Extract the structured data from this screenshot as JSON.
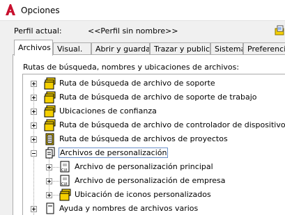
{
  "window": {
    "title": "Opciones"
  },
  "profile": {
    "label": "Perfil actual:",
    "value": "<<Perfil sin nombre>>"
  },
  "tabs": [
    {
      "label": "Archivos"
    },
    {
      "label": "Visual."
    },
    {
      "label": "Abrir y guardar"
    },
    {
      "label": "Trazar y publicar"
    },
    {
      "label": "Sistema"
    },
    {
      "label": "Preferencias de usuario"
    }
  ],
  "section_label": "Rutas de búsqueda, nombres y ubicaciones de archivos:",
  "tree": {
    "items": [
      {
        "label": "Ruta de búsqueda de archivo de soporte"
      },
      {
        "label": "Ruta de búsqueda de archivo de soporte de trabajo"
      },
      {
        "label": "Ubicaciones de confianza"
      },
      {
        "label": "Ruta de búsqueda de archivo de controlador de dispositivos"
      },
      {
        "label": "Ruta de búsqueda de archivos de proyectos"
      },
      {
        "label": "Archivos de personalización"
      },
      {
        "label": "Archivo de personalización principal"
      },
      {
        "label": "Archivo de personalización de empresa"
      },
      {
        "label": "Ubicación de iconos personalizados"
      },
      {
        "label": "Ayuda y nombres de archivos varios"
      }
    ]
  },
  "colors": {
    "app_logo": "#c8102e",
    "folder_yellow": "#f5d000",
    "selection_border": "#6a8fc9"
  }
}
